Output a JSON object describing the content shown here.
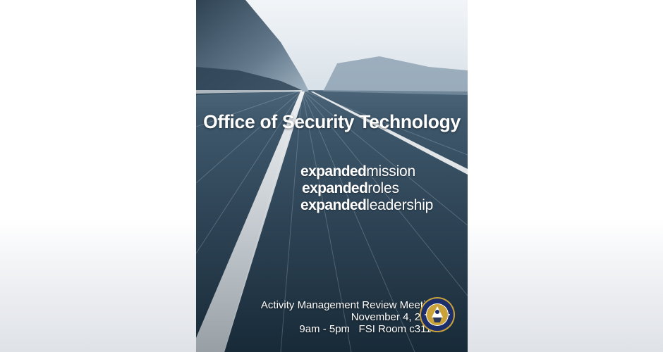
{
  "poster": {
    "title": "Office of Security Technology",
    "taglines": [
      {
        "bold": "expanded",
        "light": "mission"
      },
      {
        "bold": "expanded",
        "light": "roles"
      },
      {
        "bold": "expanded",
        "light": "leadership"
      }
    ],
    "meeting": {
      "name": "Activity Management Review Meeting",
      "date": "November 4, 2011",
      "time_location": "9am - 5pm   FSI Room c3114"
    },
    "seal_icon": "department-seal-icon"
  },
  "colors": {
    "page_background": "#ffffff",
    "poster_dark": "#142432",
    "poster_mid": "#3d5a70",
    "sky": "#e8eef3",
    "text": "#ffffff",
    "seal_blue": "#1d2f6a",
    "seal_gold": "#c9a23a"
  }
}
